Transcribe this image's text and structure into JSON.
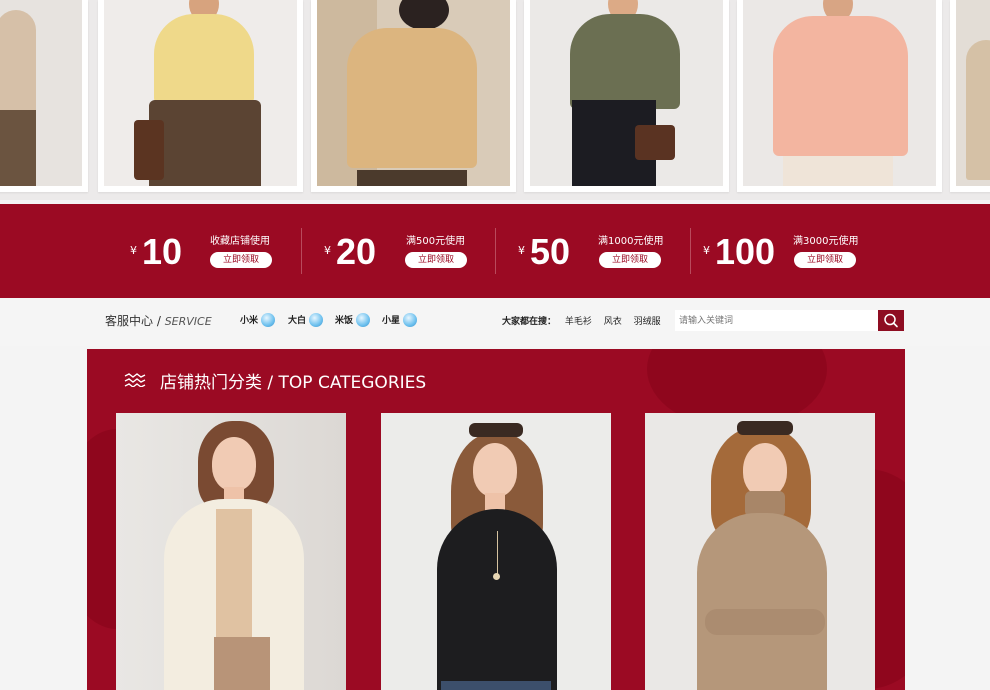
{
  "coupons": [
    {
      "currency": "¥",
      "amount": "10",
      "condition": "收藏店铺使用",
      "button": "立即领取"
    },
    {
      "currency": "¥",
      "amount": "20",
      "condition": "满500元使用",
      "button": "立即领取"
    },
    {
      "currency": "¥",
      "amount": "50",
      "condition": "满1000元使用",
      "button": "立即领取"
    },
    {
      "currency": "¥",
      "amount": "100",
      "condition": "满3000元使用",
      "button": "立即领取"
    }
  ],
  "service": {
    "title": "客服中心 /",
    "title_en": "SERVICE",
    "agents": [
      "小米",
      "大白",
      "米饭",
      "小星"
    ]
  },
  "hot_search": {
    "label": "大家都在搜：",
    "terms": [
      "羊毛衫",
      "风衣",
      "羽绒服"
    ]
  },
  "search": {
    "placeholder": "请输入关键词"
  },
  "categories": {
    "title": "店铺热门分类 / TOP CATEGORIES"
  },
  "colors": {
    "brand": "#9b0a23",
    "button_text": "#9b0a23"
  }
}
